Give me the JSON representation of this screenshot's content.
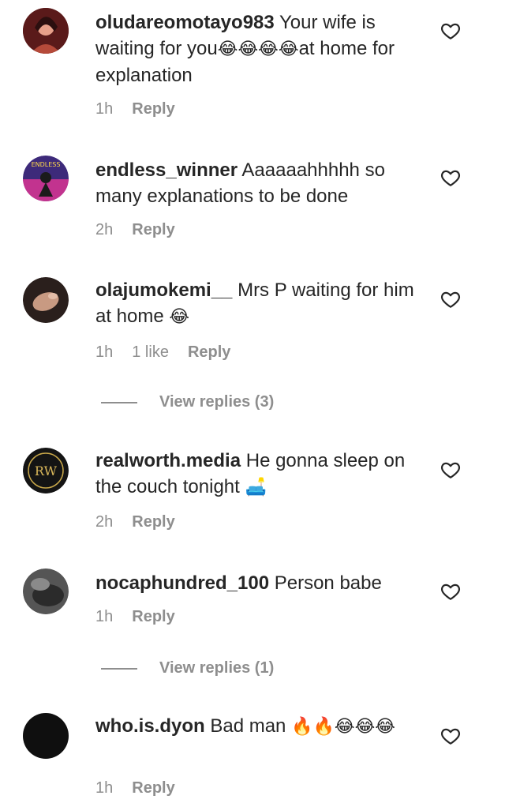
{
  "comments": [
    {
      "username": "oludareomotayo983",
      "text": " Your wife is waiting for you",
      "emoji_a": "😂😂😂😂",
      "text_b": "at home for explanation",
      "time": "1h",
      "likes": "",
      "reply": "Reply"
    },
    {
      "username": "endless_winner",
      "text": " Aaaaaahhhhh so many explanations to be done",
      "time": "2h",
      "likes": "",
      "reply": "Reply"
    },
    {
      "username": "olajumokemi__",
      "text": " Mrs P waiting for him at home ",
      "emoji_a": "😂",
      "time": "1h",
      "likes": "1 like",
      "reply": "Reply"
    },
    {
      "username": "realworth.media",
      "text": " He gonna sleep on the couch tonight ",
      "emoji_a": "🛋️",
      "time": "2h",
      "likes": "",
      "reply": "Reply"
    },
    {
      "username": "nocaphundred_100",
      "text": " Person babe",
      "time": "1h",
      "likes": "",
      "reply": "Reply"
    },
    {
      "username": "who.is.dyon",
      "text": " Bad man ",
      "emoji_a": "🔥🔥😂😂😂",
      "time": "1h",
      "likes": "",
      "reply": "Reply"
    }
  ],
  "view_replies": [
    "View replies (3)",
    "View replies (1)"
  ],
  "avatar_texts": {
    "endless": "ENDLESS",
    "realworth": "RW"
  },
  "icons": {
    "heart": "heart-outline-icon"
  },
  "colors": {
    "text": "#262626",
    "meta": "#8e8e8e",
    "background": "#ffffff"
  }
}
